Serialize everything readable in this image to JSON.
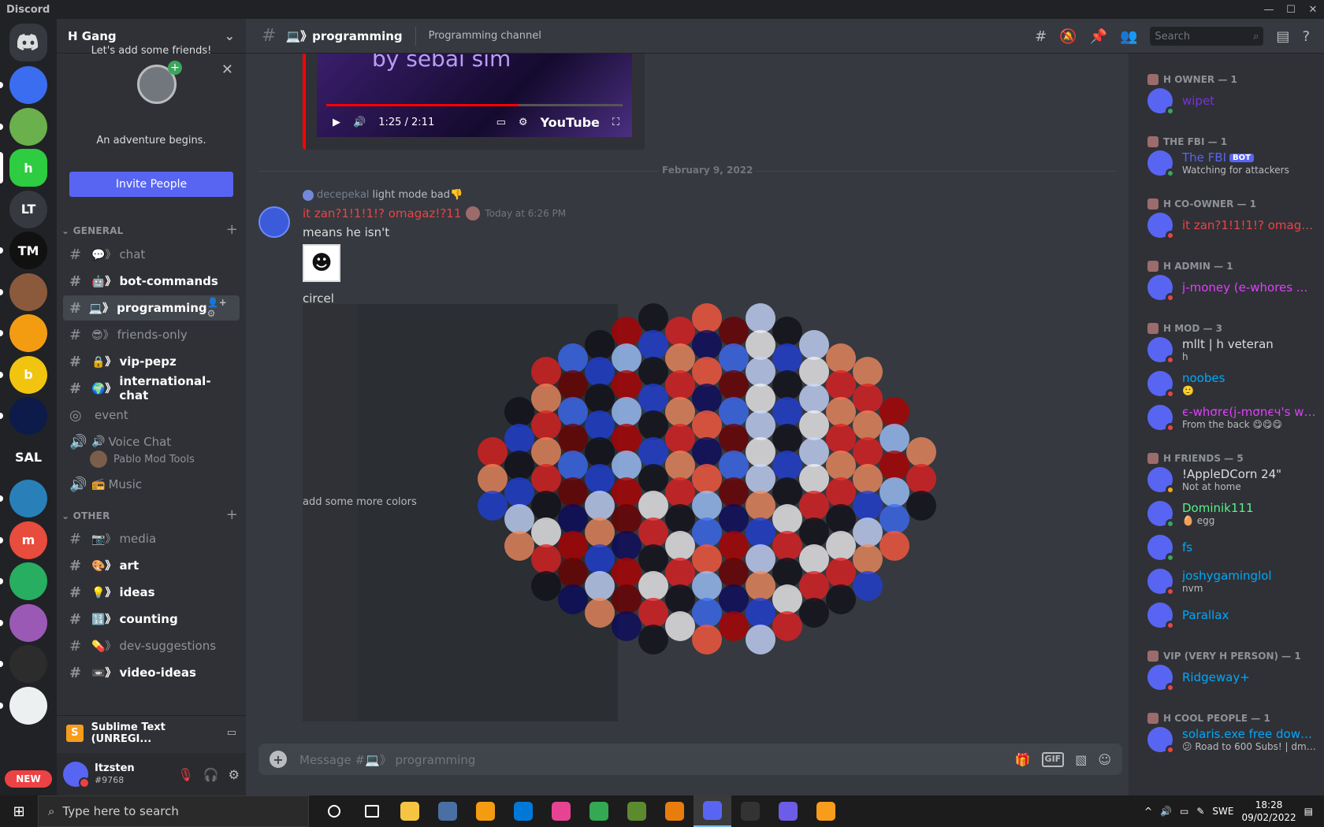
{
  "window": {
    "title": "Discord"
  },
  "guild": {
    "name": "H Gang"
  },
  "friends_card": {
    "line1": "An adventure begins.",
    "line2": "Let's add some friends!",
    "invite_label": "Invite People"
  },
  "servers": [
    {
      "label": "",
      "color": "#3b6df0"
    },
    {
      "label": "",
      "color": "#6ab04c"
    },
    {
      "label": "h",
      "color": "#2ecc40"
    },
    {
      "label": "LT",
      "color": "#36393f"
    },
    {
      "label": "TM",
      "color": "#111111"
    },
    {
      "label": "",
      "color": "#8b5a3c"
    },
    {
      "label": "",
      "color": "#f39c12"
    },
    {
      "label": "b",
      "color": "#f1c40f"
    },
    {
      "label": "",
      "color": "#0d1b4a"
    },
    {
      "label": "SAL",
      "color": "#202225"
    },
    {
      "label": "",
      "color": "#2980b9"
    },
    {
      "label": "m",
      "color": "#e74c3c"
    },
    {
      "label": "",
      "color": "#27ae60"
    },
    {
      "label": "",
      "color": "#9b59b6"
    },
    {
      "label": "",
      "color": "#2c2c2c"
    },
    {
      "label": "",
      "color": "#ecf0f1"
    }
  ],
  "new_badge": "NEW",
  "categories": {
    "general": "GENERAL",
    "other": "OTHER"
  },
  "channels_general": [
    {
      "name": "chat",
      "emoji": "💬》",
      "state": "muted"
    },
    {
      "name": "bot-commands",
      "emoji": "🤖》",
      "state": "unread"
    },
    {
      "name": "programming",
      "emoji": "💻》",
      "state": "selected"
    },
    {
      "name": "friends-only",
      "emoji": "😎》",
      "state": "muted"
    },
    {
      "name": "vip-pepz",
      "emoji": "🔒》",
      "state": "unread"
    },
    {
      "name": "international-chat",
      "emoji": "🌍》",
      "state": "unread"
    },
    {
      "name": "event",
      "emoji": "",
      "state": "muted"
    },
    {
      "name": "Voice Chat",
      "emoji": "🔊",
      "state": "muted"
    }
  ],
  "voice_user": "Pablo Mod Tools",
  "music_channel": {
    "name": "Music",
    "emoji": "📻"
  },
  "channels_other": [
    {
      "name": "media",
      "emoji": "📷》",
      "state": "muted"
    },
    {
      "name": "art",
      "emoji": "🎨》",
      "state": "unread"
    },
    {
      "name": "ideas",
      "emoji": "💡》",
      "state": "unread"
    },
    {
      "name": "counting",
      "emoji": "🔢》",
      "state": "unread"
    },
    {
      "name": "dev-suggestions",
      "emoji": "💊》",
      "state": "muted"
    },
    {
      "name": "video-ideas",
      "emoji": "📼》",
      "state": "unread"
    }
  ],
  "activity": {
    "title": "Sublime Text (UNREGI..."
  },
  "user": {
    "name": "Itzsten",
    "disc": "#9768"
  },
  "header": {
    "channel": "💻》programming",
    "topic": "Programming channel",
    "search_placeholder": "Search"
  },
  "embed": {
    "caption": "by sebai sim",
    "time": "1:25 / 2:11",
    "brand": "YouTube",
    "progress": 0.65
  },
  "date_separator": "February 9, 2022",
  "message": {
    "reply_author": "decepekal",
    "reply_text": "light mode bad👎",
    "author": "it zan?1!1!1!? omagaz!?11",
    "timestamp": "Today at 6:26 PM",
    "line1": "means he isn't",
    "line2": "circel",
    "overlay_text": "add some more colors"
  },
  "composer": {
    "placeholder": "Message #💻》 programming"
  },
  "roles": [
    {
      "name": "H OWNER — 1",
      "members": [
        {
          "name": "wipet",
          "color": "#7b2fe0",
          "sub": "",
          "status": "#3ba55d"
        }
      ]
    },
    {
      "name": "THE FBI — 1",
      "members": [
        {
          "name": "The FBI",
          "color": "#5865f2",
          "sub": "Watching for attackers",
          "status": "#3ba55d",
          "bot": "BOT"
        }
      ]
    },
    {
      "name": "H CO-OWNER — 1",
      "members": [
        {
          "name": "it zan?1!1!1!? omagaz!?11",
          "color": "#ed4245",
          "sub": "",
          "status": "#ed4245"
        }
      ]
    },
    {
      "name": "H ADMIN — 1",
      "members": [
        {
          "name": "j-money (e-whores ...",
          "color": "#e040fb",
          "sub": "",
          "status": "#ed4245"
        }
      ]
    },
    {
      "name": "H MOD — 3",
      "members": [
        {
          "name": "mllt | h veteran",
          "color": "#dcddde",
          "sub": "h",
          "status": "#ed4245"
        },
        {
          "name": "noobes",
          "color": "#00a8fc",
          "sub": "🙂",
          "status": "#ed4245"
        },
        {
          "name": "є-whσrє(j-mσnєч's wif...",
          "color": "#e040fb",
          "sub": "From the back 😋😋😋",
          "status": "#ed4245"
        }
      ]
    },
    {
      "name": "H FRIENDS — 5",
      "members": [
        {
          "name": "!AppleDCorn 24\"",
          "color": "#dcddde",
          "sub": "Not at home",
          "status": "#faa61a"
        },
        {
          "name": "Dominik111",
          "color": "#57f287",
          "sub": "🥚 egg",
          "status": "#3ba55d"
        },
        {
          "name": "fs",
          "color": "#00a8fc",
          "sub": "",
          "status": "#3ba55d"
        },
        {
          "name": "joshygaminglol",
          "color": "#00a8fc",
          "sub": "nvm",
          "status": "#ed4245"
        },
        {
          "name": "Parallax",
          "color": "#00a8fc",
          "sub": "",
          "status": "#ed4245"
        }
      ]
    },
    {
      "name": "VIP (VERY H PERSON) — 1",
      "members": [
        {
          "name": "Ridgeway+",
          "color": "#00a8fc",
          "sub": "",
          "status": "#ed4245"
        }
      ]
    },
    {
      "name": "H COOL PEOPLE — 1",
      "members": [
        {
          "name": "solaris.exe free downl...",
          "color": "#00a8fc",
          "sub": "😕 Road to 600 Subs! | dm me...",
          "status": "#ed4245"
        }
      ]
    }
  ],
  "taskbar": {
    "search_placeholder": "Type here to search",
    "lang": "SWE",
    "time": "18:28",
    "date": "09/02/2022"
  },
  "taskbar_apps": [
    {
      "name": "cortana",
      "color": "#1c1c1c"
    },
    {
      "name": "task-view",
      "color": "#1c1c1c"
    },
    {
      "name": "file-explorer",
      "color": "#f5c542"
    },
    {
      "name": "vr-app",
      "color": "#4a6fa5"
    },
    {
      "name": "fl-studio",
      "color": "#f39c12"
    },
    {
      "name": "store",
      "color": "#0078d7"
    },
    {
      "name": "osu",
      "color": "#e84393"
    },
    {
      "name": "chrome",
      "color": "#34a853"
    },
    {
      "name": "minecraft",
      "color": "#5c8a2e"
    },
    {
      "name": "blender",
      "color": "#e87d0d"
    },
    {
      "name": "discord",
      "color": "#5865f2"
    },
    {
      "name": "terminal",
      "color": "#333333"
    },
    {
      "name": "app-purple",
      "color": "#6c5ce7"
    },
    {
      "name": "sublime-text",
      "color": "#f89c1c"
    }
  ]
}
